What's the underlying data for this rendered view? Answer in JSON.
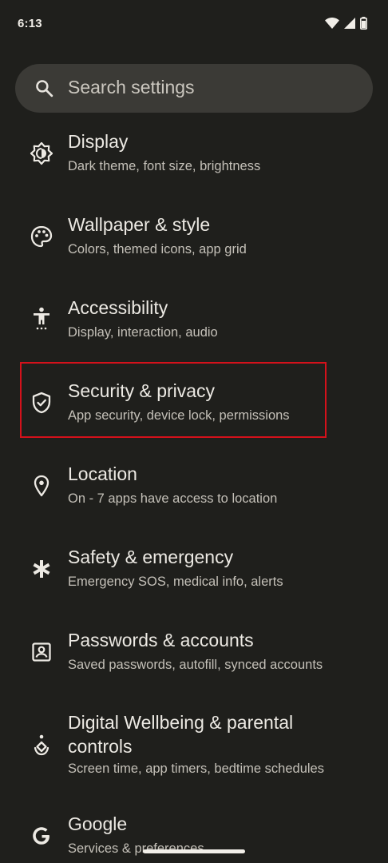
{
  "status_bar": {
    "time": "6:13",
    "icons": [
      "wifi-icon",
      "cell-signal-icon",
      "battery-icon"
    ]
  },
  "search": {
    "placeholder": "Search settings",
    "icon": "search-icon"
  },
  "settings": [
    {
      "title": "Display",
      "subtitle": "Dark theme, font size, brightness",
      "icon": "brightness-icon"
    },
    {
      "title": "Wallpaper & style",
      "subtitle": "Colors, themed icons, app grid",
      "icon": "palette-icon"
    },
    {
      "title": "Accessibility",
      "subtitle": "Display, interaction, audio",
      "icon": "accessibility-icon"
    },
    {
      "title": "Security & privacy",
      "subtitle": "App security, device lock, permissions",
      "icon": "shield-icon",
      "highlighted": true
    },
    {
      "title": "Location",
      "subtitle": "On - 7 apps have access to location",
      "icon": "location-pin-icon"
    },
    {
      "title": "Safety & emergency",
      "subtitle": "Emergency SOS, medical info, alerts",
      "icon": "asterisk-icon"
    },
    {
      "title": "Passwords & accounts",
      "subtitle": "Saved passwords, autofill, synced accounts",
      "icon": "account-box-icon"
    },
    {
      "title": "Digital Wellbeing & parental controls",
      "subtitle": "Screen time, app timers, bedtime schedules",
      "icon": "wellbeing-icon"
    },
    {
      "title": "Google",
      "subtitle": "Services & preferences",
      "icon": "google-icon"
    }
  ],
  "colors": {
    "background": "#1f1f1c",
    "search_bar": "#3b3a36",
    "highlight_border": "#d4111b",
    "text_primary": "#ece9e3",
    "text_secondary": "#c4c0b8"
  }
}
